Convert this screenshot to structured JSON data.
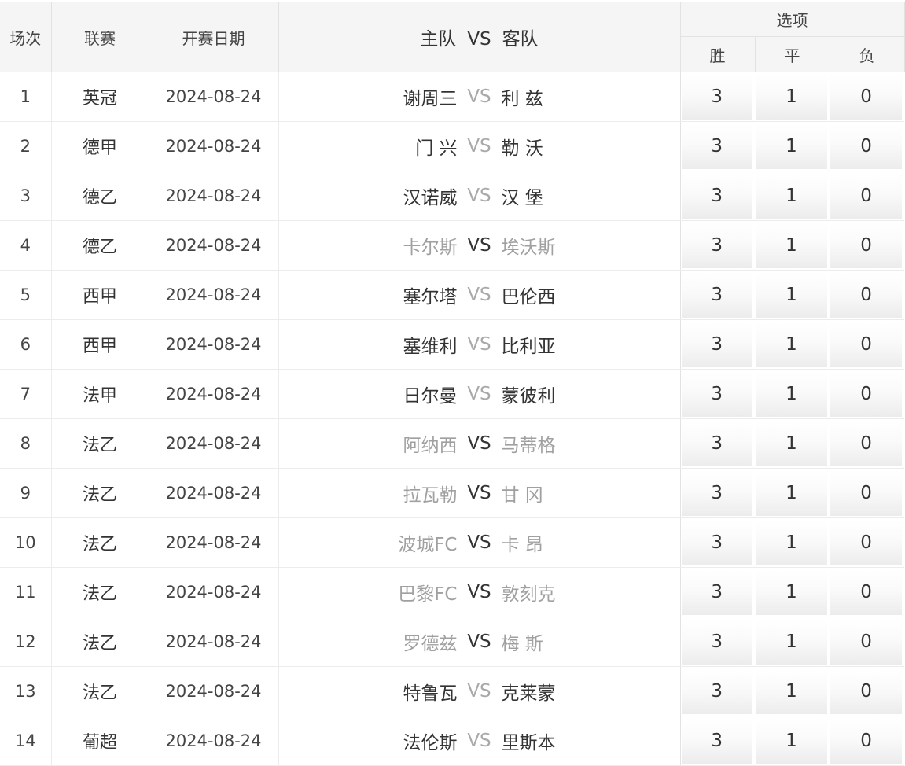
{
  "header": {
    "num": "场次",
    "league": "联赛",
    "date": "开赛日期",
    "home": "主队",
    "vs": "VS",
    "away": "客队",
    "options": "选项",
    "win": "胜",
    "draw": "平",
    "lose": "负"
  },
  "rows": [
    {
      "num": "1",
      "league": "英冠",
      "date": "2024-08-24",
      "home": "谢周三",
      "vs": "VS",
      "away": "利 兹",
      "win": "3",
      "draw": "1",
      "lose": "0",
      "faded": false
    },
    {
      "num": "2",
      "league": "德甲",
      "date": "2024-08-24",
      "home": "门 兴",
      "vs": "VS",
      "away": "勒 沃",
      "win": "3",
      "draw": "1",
      "lose": "0",
      "faded": false
    },
    {
      "num": "3",
      "league": "德乙",
      "date": "2024-08-24",
      "home": "汉诺威",
      "vs": "VS",
      "away": "汉 堡",
      "win": "3",
      "draw": "1",
      "lose": "0",
      "faded": false
    },
    {
      "num": "4",
      "league": "德乙",
      "date": "2024-08-24",
      "home": "卡尔斯",
      "vs": "VS",
      "away": "埃沃斯",
      "win": "3",
      "draw": "1",
      "lose": "0",
      "faded": true
    },
    {
      "num": "5",
      "league": "西甲",
      "date": "2024-08-24",
      "home": "塞尔塔",
      "vs": "VS",
      "away": "巴伦西",
      "win": "3",
      "draw": "1",
      "lose": "0",
      "faded": false
    },
    {
      "num": "6",
      "league": "西甲",
      "date": "2024-08-24",
      "home": "塞维利",
      "vs": "VS",
      "away": "比利亚",
      "win": "3",
      "draw": "1",
      "lose": "0",
      "faded": false
    },
    {
      "num": "7",
      "league": "法甲",
      "date": "2024-08-24",
      "home": "日尔曼",
      "vs": "VS",
      "away": "蒙彼利",
      "win": "3",
      "draw": "1",
      "lose": "0",
      "faded": false
    },
    {
      "num": "8",
      "league": "法乙",
      "date": "2024-08-24",
      "home": "阿纳西",
      "vs": "VS",
      "away": "马蒂格",
      "win": "3",
      "draw": "1",
      "lose": "0",
      "faded": true
    },
    {
      "num": "9",
      "league": "法乙",
      "date": "2024-08-24",
      "home": "拉瓦勒",
      "vs": "VS",
      "away": "甘 冈",
      "win": "3",
      "draw": "1",
      "lose": "0",
      "faded": true
    },
    {
      "num": "10",
      "league": "法乙",
      "date": "2024-08-24",
      "home": "波城FC",
      "vs": "VS",
      "away": "卡 昂",
      "win": "3",
      "draw": "1",
      "lose": "0",
      "faded": true
    },
    {
      "num": "11",
      "league": "法乙",
      "date": "2024-08-24",
      "home": "巴黎FC",
      "vs": "VS",
      "away": "敦刻克",
      "win": "3",
      "draw": "1",
      "lose": "0",
      "faded": true
    },
    {
      "num": "12",
      "league": "法乙",
      "date": "2024-08-24",
      "home": "罗德兹",
      "vs": "VS",
      "away": "梅 斯",
      "win": "3",
      "draw": "1",
      "lose": "0",
      "faded": true
    },
    {
      "num": "13",
      "league": "法乙",
      "date": "2024-08-24",
      "home": "特鲁瓦",
      "vs": "VS",
      "away": "克莱蒙",
      "win": "3",
      "draw": "1",
      "lose": "0",
      "faded": false
    },
    {
      "num": "14",
      "league": "葡超",
      "date": "2024-08-24",
      "home": "法伦斯",
      "vs": "VS",
      "away": "里斯本",
      "win": "3",
      "draw": "1",
      "lose": "0",
      "faded": false
    }
  ]
}
